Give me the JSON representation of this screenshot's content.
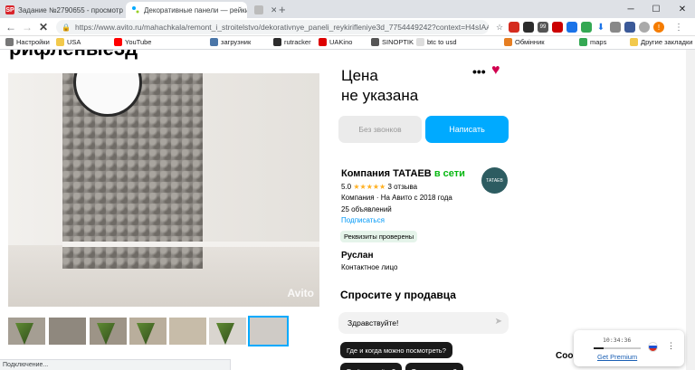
{
  "browser": {
    "tabs": [
      {
        "label": "Задание №2790655 - просмотр з...",
        "favicon": "SP"
      },
      {
        "label": "Декоративные панели — рейкир...",
        "favicon": ""
      },
      {
        "label": "",
        "favicon": ""
      }
    ],
    "url": "https://www.avito.ru/mahachkala/remont_i_stroitelstvo/dekorativnye_paneli_reykirifleniye3d_7754449242?context=H4sIAAAAAA...",
    "bookmarks": [
      "Настройки",
      "USA",
      "YouTube",
      "загрузник",
      "rutracker",
      "UAKino",
      "SINOPTIK",
      "btc to usd",
      "Обмінник",
      "maps",
      "Другие закладки"
    ],
    "ext_badge": "99"
  },
  "page": {
    "heading_fragment": "рифленые3д",
    "photo_watermark": "Avito",
    "price_line1": "Цена",
    "price_line2": "не указана",
    "more_menu": "•••",
    "no_calls_button": "Без звонков",
    "write_button": "Написать",
    "seller_name": "Компания ТАТАЕВ",
    "seller_status": "в сети",
    "rating_value": "5.0",
    "stars": "★★★★★",
    "reviews": "3 отзыва",
    "seller_since": "Компания · На Авито с 2018 года",
    "listings": "25 объявлений",
    "subscribe": "Подписаться",
    "verified_badge": "Реквизиты проверены",
    "logo_text": "ТАТАЕВ",
    "contact_name": "Руслан",
    "contact_role": "Контактное лицо",
    "ask_title": "Спросите у продавца",
    "message_placeholder": "Здравствуйте!",
    "chips": [
      "Где и когда можно посмотреть?",
      "Ещё продаёте?",
      "Торг уместен?"
    ]
  },
  "status_bar": "Подключение...",
  "vpn": {
    "time": "10:34:36",
    "premium_link": "Get Premium",
    "progress": 0.22
  },
  "cookie_text": "Coo"
}
